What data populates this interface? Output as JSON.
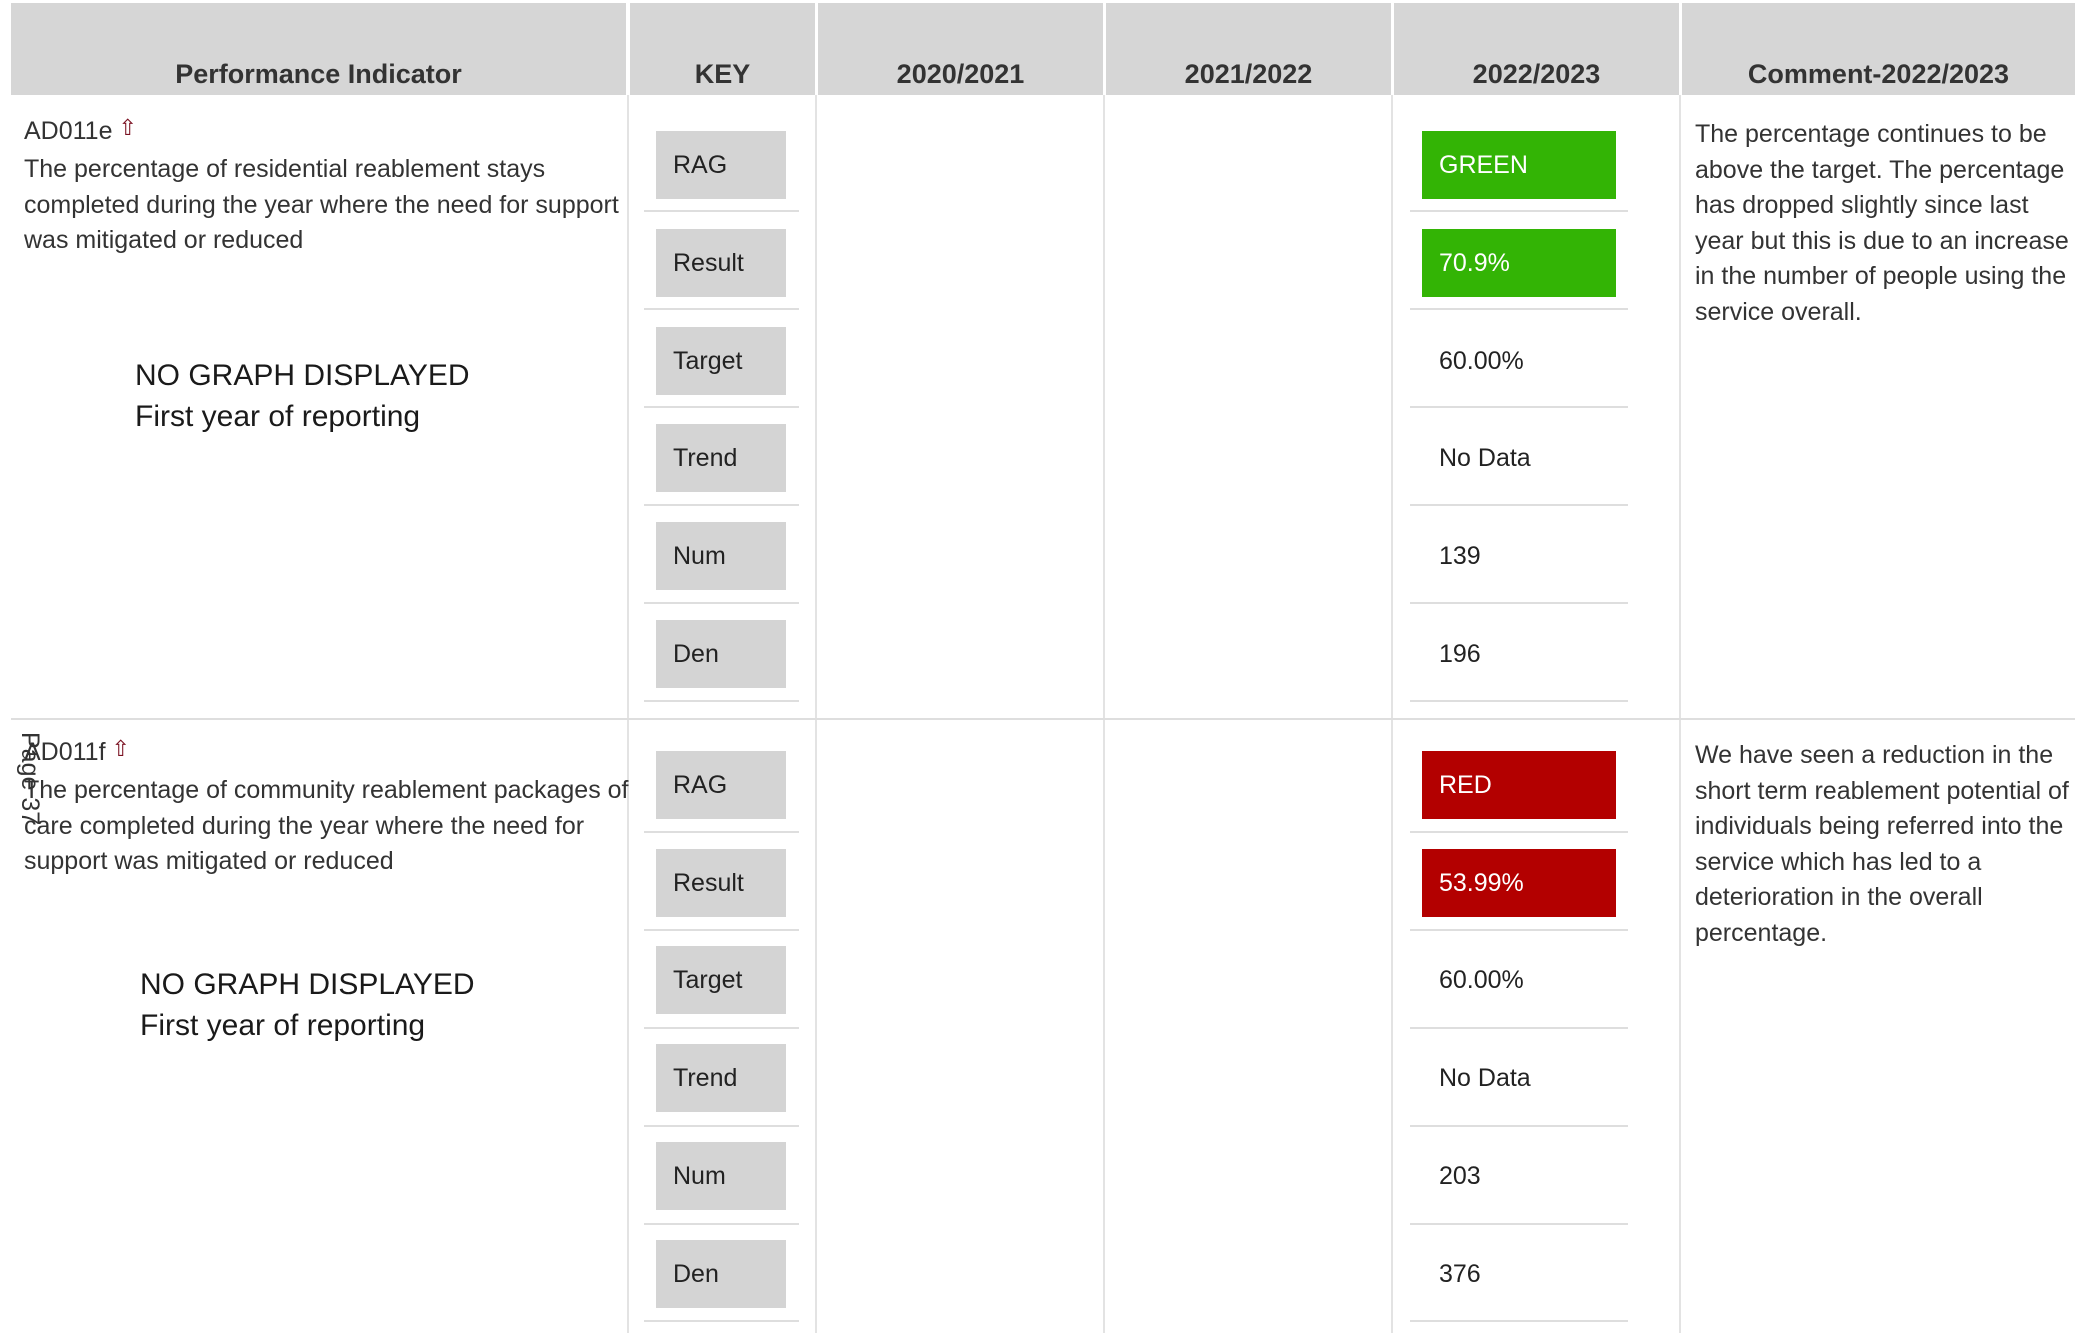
{
  "header": {
    "col_pi": "Performance Indicator",
    "col_key": "KEY",
    "col_y1": "2020/2021",
    "col_y2": "2021/2022",
    "col_y3": "2022/2023",
    "col_comment": "Comment-2022/2023"
  },
  "colors": {
    "green": "#33b405",
    "red": "#b30000",
    "header_bg": "#d6d6d6",
    "key_bg": "#d4d4d4"
  },
  "key_labels": [
    "RAG",
    "Result",
    "Target",
    "Trend",
    "Num",
    "Den"
  ],
  "indicators": [
    {
      "code": "AD011e",
      "arrow_icon": "up-arrow-icon",
      "description": "The percentage of residential reablement stays completed during the year where the need for support was mitigated or reduced",
      "no_graph": "NO GRAPH DISPLAYED",
      "no_graph_reason": "First year of reporting",
      "values": {
        "rag": "GREEN",
        "result": "70.9%",
        "target": "60.00%",
        "trend": "No Data",
        "num": "139",
        "den": "196"
      },
      "comment": "The percentage continues to be above the target. The percentage has dropped slightly since last year but this is due to an increase in the number of people using the service overall."
    },
    {
      "code": "AD011f",
      "arrow_icon": "up-arrow-icon",
      "description": "The percentage of community reablement packages of care completed during the year where the need for support was mitigated or reduced",
      "no_graph": "NO GRAPH DISPLAYED",
      "no_graph_reason": "First year of reporting",
      "values": {
        "rag": "RED",
        "result": "53.99%",
        "target": "60.00%",
        "trend": "No Data",
        "num": "203",
        "den": "376"
      },
      "comment": "We have seen a reduction in the short term reablement potential of individuals being referred into the service which has led to a deterioration in the overall percentage."
    }
  ],
  "page_label": "Page 37"
}
